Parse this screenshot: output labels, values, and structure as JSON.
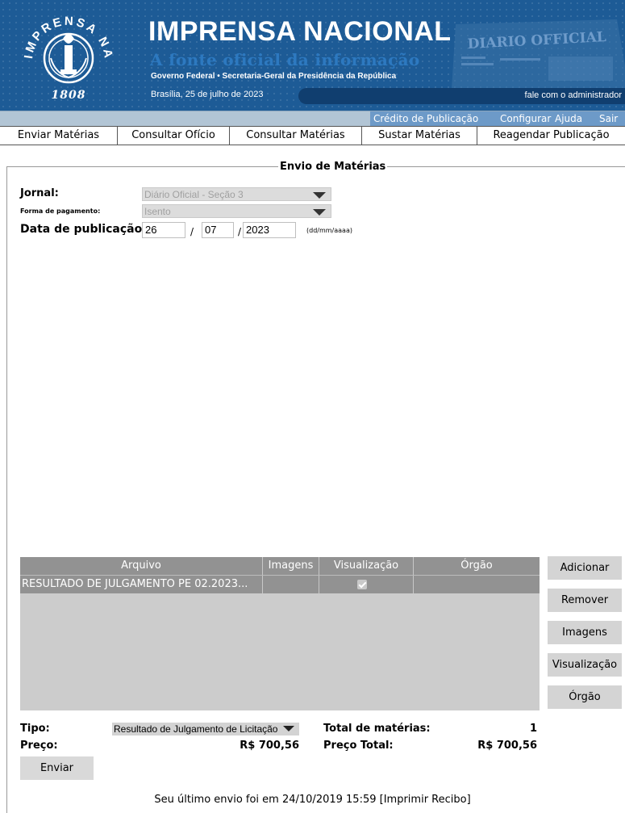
{
  "header": {
    "seal_text": "IMPRENSA NACIONAL",
    "seal_year": "1808",
    "title": "IMPRENSA NACIONAL",
    "slogan": "A fonte oficial da informação",
    "gov_line": "Governo Federal • Secretaria-Geral da Presidência da República",
    "date_line": "Brasília, 25 de julho de 2023",
    "admin_link": "fale com o administrador",
    "newspaper_title": "DIARIO OFFICIAL"
  },
  "topnav": {
    "items": [
      "Crédito de Publicação",
      "Configurar",
      "Ajuda",
      "Sair"
    ]
  },
  "tabs": [
    "Enviar Matérias",
    "Consultar Ofício",
    "Consultar Matérias",
    "Sustar Matérias",
    "Reagendar Publicação"
  ],
  "form": {
    "legend": "Envio de Matérias",
    "jornal_label": "Jornal:",
    "jornal_value": "Diário Oficial - Seção 3",
    "pagamento_label": "Forma de pagamento:",
    "pagamento_value": "Isento",
    "data_label": "Data de publicação:",
    "day": "26",
    "month": "07",
    "year": "2023",
    "slash": "/",
    "date_hint": "(dd/mm/aaaa)"
  },
  "table": {
    "columns": [
      "Arquivo",
      "Imagens",
      "Visualização",
      "Órgão"
    ],
    "rows": [
      {
        "arquivo": "RESULTADO DE JULGAMENTO PE 02.2023...",
        "imagens": "",
        "visualizacao": true,
        "orgao": ""
      }
    ]
  },
  "side_buttons": [
    "Adicionar",
    "Remover",
    "Imagens",
    "Visualização",
    "Órgão"
  ],
  "summary": {
    "tipo_label": "Tipo:",
    "tipo_value": "Resultado de Julgamento de Licitação",
    "preco_label": "Preço:",
    "preco_value": "R$ 700,56",
    "total_label": "Total de matérias:",
    "total_value": "1",
    "preco_total_label": "Preço Total:",
    "preco_total_value": "R$ 700,56",
    "enviar_label": "Enviar"
  },
  "footer": {
    "last_send_text": "Seu último envio foi em 24/10/2019 15:59",
    "recibo_link": "[Imprimir Recibo]"
  },
  "colors": {
    "header_bg": "#1d5b96",
    "topnav_button": "#6d9ac8",
    "table_header": "#929292",
    "table_body": "#cccccc"
  }
}
